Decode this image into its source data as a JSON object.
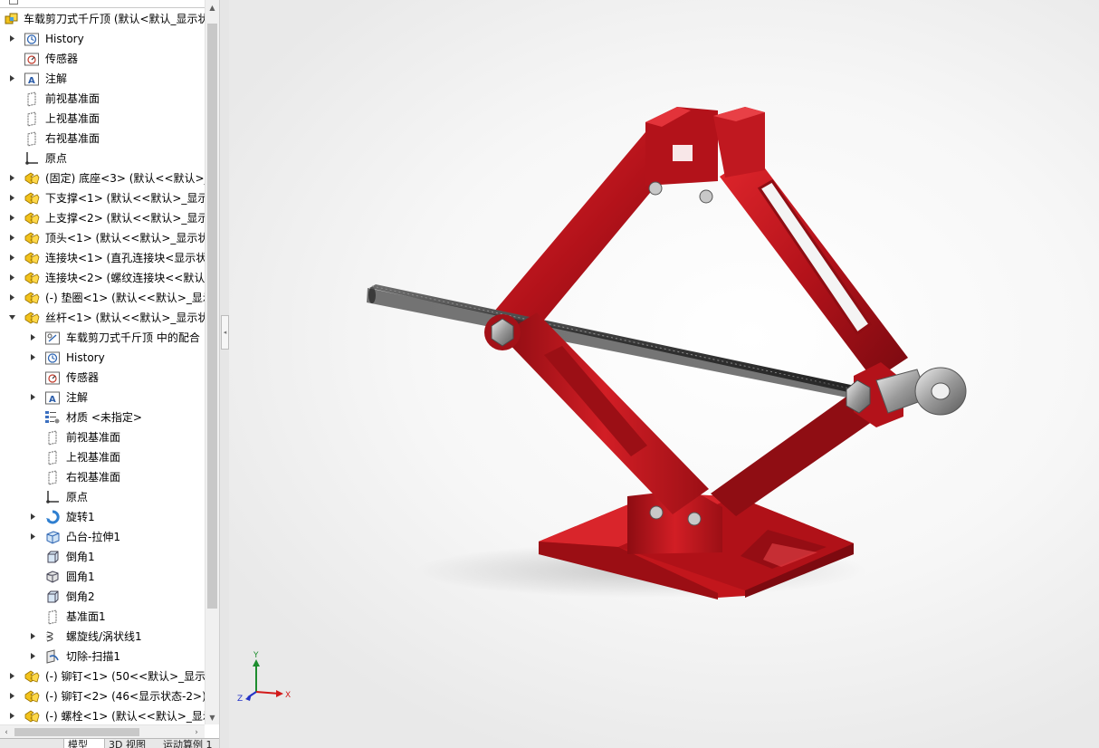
{
  "feature_tree": {
    "items": [
      {
        "label": "车载剪刀式千斤顶 (默认<默认_显示状态",
        "level": 0,
        "expander": "none",
        "icon": "assembly-icon"
      },
      {
        "label": "History",
        "level": 1,
        "expander": "collapsed",
        "icon": "history-icon"
      },
      {
        "label": "传感器",
        "level": 1,
        "expander": "none",
        "icon": "sensor-icon"
      },
      {
        "label": "注解",
        "level": 1,
        "expander": "collapsed",
        "icon": "annotation-icon"
      },
      {
        "label": "前视基准面",
        "level": 1,
        "expander": "none",
        "icon": "plane-icon"
      },
      {
        "label": "上视基准面",
        "level": 1,
        "expander": "none",
        "icon": "plane-icon"
      },
      {
        "label": "右视基准面",
        "level": 1,
        "expander": "none",
        "icon": "plane-icon"
      },
      {
        "label": "原点",
        "level": 1,
        "expander": "none",
        "icon": "origin-icon"
      },
      {
        "label": "(固定) 底座<3> (默认<<默认>_",
        "level": 1,
        "expander": "collapsed",
        "icon": "part-icon"
      },
      {
        "label": "下支撑<1> (默认<<默认>_显示",
        "level": 1,
        "expander": "collapsed",
        "icon": "part-icon"
      },
      {
        "label": "上支撑<2> (默认<<默认>_显示",
        "level": 1,
        "expander": "collapsed",
        "icon": "part-icon"
      },
      {
        "label": "顶头<1> (默认<<默认>_显示状",
        "level": 1,
        "expander": "collapsed",
        "icon": "part-icon"
      },
      {
        "label": "连接块<1> (直孔连接块<显示状",
        "level": 1,
        "expander": "collapsed",
        "icon": "part-icon"
      },
      {
        "label": "连接块<2> (螺纹连接块<<默认:",
        "level": 1,
        "expander": "collapsed",
        "icon": "part-icon"
      },
      {
        "label": "(-) 垫圈<1> (默认<<默认>_显示",
        "level": 1,
        "expander": "collapsed",
        "icon": "part-icon"
      },
      {
        "label": "丝杆<1> (默认<<默认>_显示状",
        "level": 1,
        "expander": "expanded",
        "icon": "part-icon"
      },
      {
        "label": "车载剪刀式千斤顶 中的配合",
        "level": 2,
        "expander": "collapsed",
        "icon": "mates-icon"
      },
      {
        "label": "History",
        "level": 2,
        "expander": "collapsed",
        "icon": "history-icon"
      },
      {
        "label": "传感器",
        "level": 2,
        "expander": "none",
        "icon": "sensor-icon"
      },
      {
        "label": "注解",
        "level": 2,
        "expander": "collapsed",
        "icon": "annotation-icon"
      },
      {
        "label": "材质 <未指定>",
        "level": 2,
        "expander": "none",
        "icon": "material-icon"
      },
      {
        "label": "前视基准面",
        "level": 2,
        "expander": "none",
        "icon": "plane-icon"
      },
      {
        "label": "上视基准面",
        "level": 2,
        "expander": "none",
        "icon": "plane-icon"
      },
      {
        "label": "右视基准面",
        "level": 2,
        "expander": "none",
        "icon": "plane-icon"
      },
      {
        "label": "原点",
        "level": 2,
        "expander": "none",
        "icon": "origin-icon"
      },
      {
        "label": "旋转1",
        "level": 2,
        "expander": "collapsed",
        "icon": "revolve-icon"
      },
      {
        "label": "凸台-拉伸1",
        "level": 2,
        "expander": "collapsed",
        "icon": "extrude-icon"
      },
      {
        "label": "倒角1",
        "level": 2,
        "expander": "none",
        "icon": "chamfer-icon"
      },
      {
        "label": "圆角1",
        "level": 2,
        "expander": "none",
        "icon": "fillet-icon"
      },
      {
        "label": "倒角2",
        "level": 2,
        "expander": "none",
        "icon": "chamfer-icon"
      },
      {
        "label": "基准面1",
        "level": 2,
        "expander": "none",
        "icon": "plane-icon"
      },
      {
        "label": "螺旋线/涡状线1",
        "level": 2,
        "expander": "collapsed",
        "icon": "helix-icon"
      },
      {
        "label": "切除-扫描1",
        "level": 2,
        "expander": "collapsed",
        "icon": "sweep-cut-icon"
      },
      {
        "label": "(-) 铆钉<1> (50<<默认>_显示状",
        "level": 1,
        "expander": "collapsed",
        "icon": "part-icon"
      },
      {
        "label": "(-) 铆钉<2> (46<显示状态-2>)",
        "level": 1,
        "expander": "collapsed",
        "icon": "part-icon"
      },
      {
        "label": "(-) 螺栓<1> (默认<<默认>_显示",
        "level": 1,
        "expander": "collapsed",
        "icon": "part-icon"
      }
    ]
  },
  "bottom_tabs": [
    {
      "label": "模型",
      "active": true
    },
    {
      "label": "3D 视图",
      "active": false
    },
    {
      "label": "运动算例 1",
      "active": false
    }
  ],
  "triad": {
    "x_label": "X",
    "y_label": "Y",
    "z_label": "Z"
  },
  "colors": {
    "accent_red": "#c8161d",
    "part_yellow": "#f2c21b",
    "viewport_bg": "#f4f4f4"
  }
}
